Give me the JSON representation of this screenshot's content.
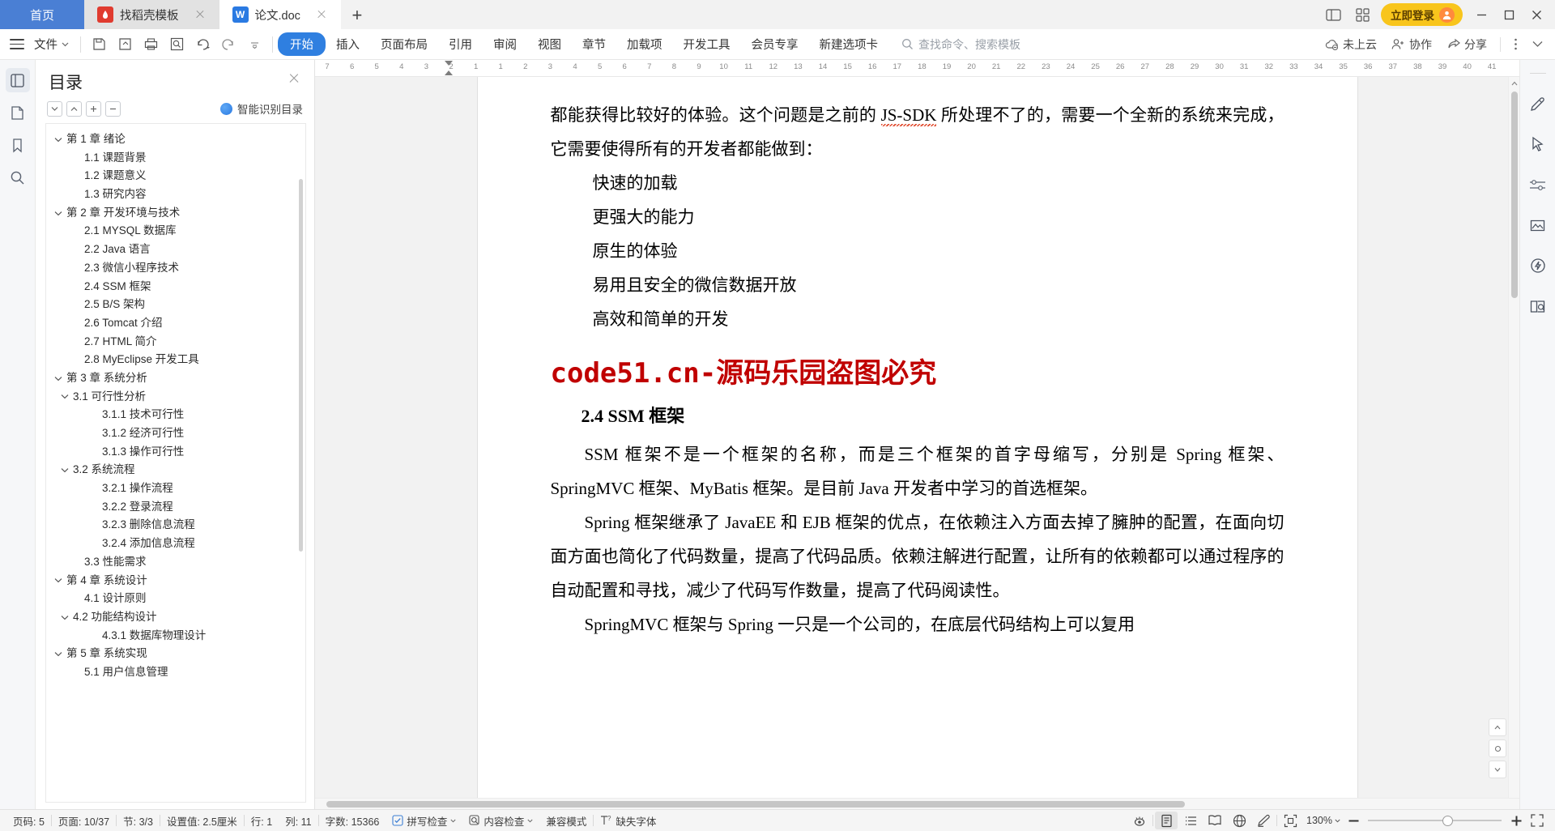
{
  "tabbar": {
    "home_label": "首页",
    "tabs": [
      {
        "label": "找稻壳模板",
        "icon": "wps-template-icon",
        "initial": "W",
        "active": false
      },
      {
        "label": "论文.doc",
        "icon": "wps-writer-icon",
        "initial": "W",
        "active": true
      }
    ],
    "new_tab": "+",
    "login_label": "立即登录"
  },
  "ribbon": {
    "file_label": "文件",
    "tabs": [
      {
        "label": "开始",
        "active": true
      },
      {
        "label": "插入",
        "active": false
      },
      {
        "label": "页面布局",
        "active": false
      },
      {
        "label": "引用",
        "active": false
      },
      {
        "label": "审阅",
        "active": false
      },
      {
        "label": "视图",
        "active": false
      },
      {
        "label": "章节",
        "active": false
      },
      {
        "label": "加载项",
        "active": false
      },
      {
        "label": "开发工具",
        "active": false
      },
      {
        "label": "会员专享",
        "active": false
      },
      {
        "label": "新建选项卡",
        "active": false
      }
    ],
    "search_placeholder": "查找命令、搜索模板",
    "cloud_label": "未上云",
    "collab_label": "协作",
    "share_label": "分享"
  },
  "toc": {
    "title": "目录",
    "smart_label": "智能识别目录",
    "items": [
      {
        "label": "第 1 章  绪论",
        "level": 1,
        "caret": "down"
      },
      {
        "label": "1.1  课题背景",
        "level": 2,
        "caret": "none"
      },
      {
        "label": "1.2  课题意义",
        "level": 2,
        "caret": "none"
      },
      {
        "label": "1.3  研究内容",
        "level": 2,
        "caret": "none"
      },
      {
        "label": "第 2 章  开发环境与技术",
        "level": 1,
        "caret": "down"
      },
      {
        "label": "2.1 MYSQL 数据库",
        "level": 2,
        "caret": "none"
      },
      {
        "label": "2.2 Java 语言",
        "level": 2,
        "caret": "none"
      },
      {
        "label": "2.3  微信小程序技术",
        "level": 2,
        "caret": "none"
      },
      {
        "label": "2.4 SSM 框架",
        "level": 2,
        "caret": "none"
      },
      {
        "label": "2.5 B/S 架构",
        "level": 2,
        "caret": "none"
      },
      {
        "label": "2.6 Tomcat  介绍",
        "level": 2,
        "caret": "none"
      },
      {
        "label": "2.7 HTML 简介",
        "level": 2,
        "caret": "none"
      },
      {
        "label": "2.8 MyEclipse 开发工具",
        "level": 2,
        "caret": "none"
      },
      {
        "label": "第 3 章  系统分析",
        "level": 1,
        "caret": "down"
      },
      {
        "label": "3.1  可行性分析",
        "level": 2,
        "caret": "down"
      },
      {
        "label": "3.1.1  技术可行性",
        "level": 3,
        "caret": "none"
      },
      {
        "label": "3.1.2  经济可行性",
        "level": 3,
        "caret": "none"
      },
      {
        "label": "3.1.3  操作可行性",
        "level": 3,
        "caret": "none"
      },
      {
        "label": "3.2  系统流程",
        "level": 2,
        "caret": "down"
      },
      {
        "label": "3.2.1  操作流程",
        "level": 3,
        "caret": "none"
      },
      {
        "label": "3.2.2  登录流程",
        "level": 3,
        "caret": "none"
      },
      {
        "label": "3.2.3  删除信息流程",
        "level": 3,
        "caret": "none"
      },
      {
        "label": "3.2.4  添加信息流程",
        "level": 3,
        "caret": "none"
      },
      {
        "label": "3.3  性能需求",
        "level": 2,
        "caret": "none"
      },
      {
        "label": "第 4 章  系统设计",
        "level": 1,
        "caret": "down"
      },
      {
        "label": "4.1  设计原则",
        "level": 2,
        "caret": "none"
      },
      {
        "label": "4.2  功能结构设计",
        "level": 2,
        "caret": "down"
      },
      {
        "label": "4.3.1  数据库物理设计",
        "level": 3,
        "caret": "none"
      },
      {
        "label": "第 5 章  系统实现",
        "level": 1,
        "caret": "down"
      },
      {
        "label": "5.1 用户信息管理",
        "level": 2,
        "caret": "none"
      }
    ]
  },
  "ruler": {
    "ticks": [
      "7",
      "6",
      "5",
      "4",
      "3",
      "2",
      "1",
      "1",
      "2",
      "3",
      "4",
      "5",
      "6",
      "7",
      "8",
      "9",
      "10",
      "11",
      "12",
      "13",
      "14",
      "15",
      "16",
      "17",
      "18",
      "19",
      "20",
      "21",
      "22",
      "23",
      "24",
      "25",
      "26",
      "27",
      "28",
      "29",
      "30",
      "31",
      "32",
      "33",
      "34",
      "35",
      "36",
      "37",
      "38",
      "39",
      "40",
      "41"
    ]
  },
  "document": {
    "paragraphs": [
      {
        "type": "body",
        "pre": "都能获得比较好的体验。这个问题是之前的 ",
        "spell": "JS-SDK",
        "post": " 所处理不了的，需要一个全新的系统来完成，它需要使得所有的开发者都能做到："
      },
      {
        "type": "list",
        "text": "快速的加载"
      },
      {
        "type": "list",
        "text": "更强大的能力"
      },
      {
        "type": "list",
        "text": "原生的体验"
      },
      {
        "type": "list",
        "text": "易用且安全的微信数据开放"
      },
      {
        "type": "list",
        "text": "高效和简单的开发"
      }
    ],
    "watermark": "code51.cn-源码乐园盗图必究",
    "heading": "2.4 SSM 框架",
    "after": [
      "SSM 框架不是一个框架的名称，而是三个框架的首字母缩写，分别是 Spring 框架、SpringMVC 框架、MyBatis 框架。是目前 Java 开发者中学习的首选框架。",
      "Spring 框架继承了 JavaEE 和 EJB 框架的优点，在依赖注入方面去掉了臃肿的配置，在面向切面方面也简化了代码数量，提高了代码品质。依赖注解进行配置，让所有的依赖都可以通过程序的自动配置和寻找，减少了代码写作数量，提高了代码阅读性。",
      "SpringMVC 框架与 Spring 一只是一个公司的，在底层代码结构上可以复用"
    ]
  },
  "status": {
    "page_number": "页码: 5",
    "page_count": "页面: 10/37",
    "section": "节: 3/3",
    "setting": "设置值: 2.5厘米",
    "row": "行: 1",
    "col": "列: 11",
    "word_count": "字数: 15366",
    "spellcheck": "拼写检查",
    "content_check": "内容检查",
    "compat_mode": "兼容模式",
    "missing_font": "缺失字体",
    "zoom": "130%"
  }
}
